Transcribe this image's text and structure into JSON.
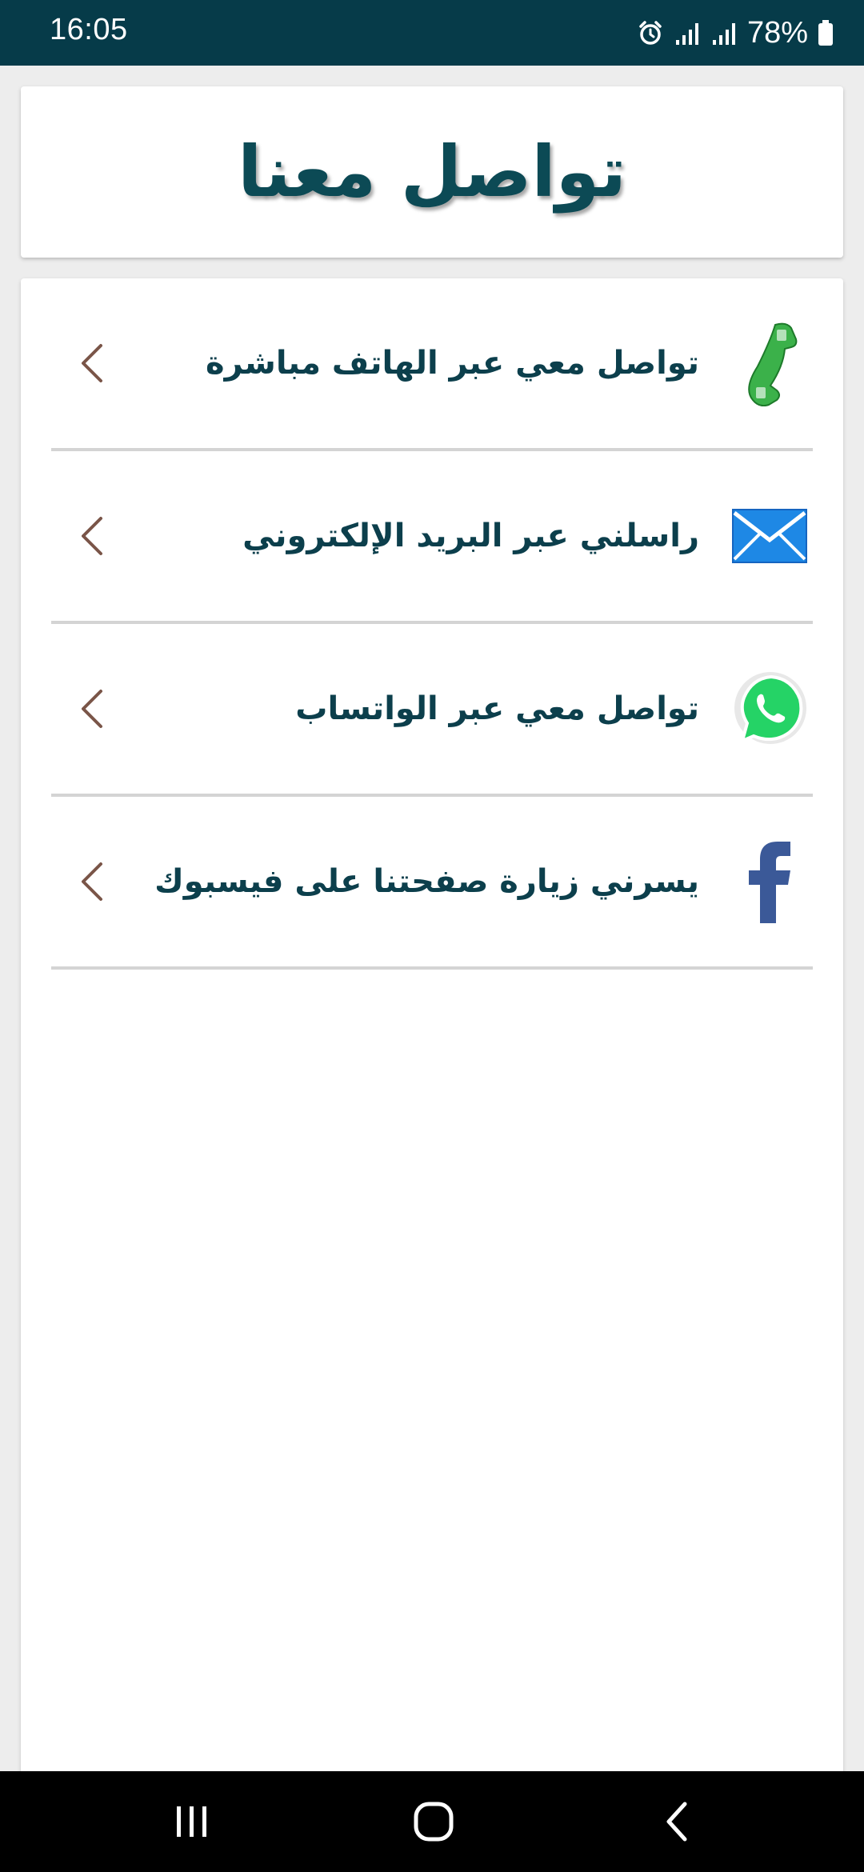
{
  "status_bar": {
    "time": "16:05",
    "battery": "78%",
    "icons": [
      "alarm-icon",
      "signal-icon",
      "signal-icon",
      "battery-icon"
    ]
  },
  "header": {
    "title": "تواصل معنا"
  },
  "contact_list": {
    "items": [
      {
        "label": "تواصل معي عبر الهاتف مباشرة",
        "icon": "phone-icon"
      },
      {
        "label": "راسلني عبر البريد الإلكتروني",
        "icon": "email-icon"
      },
      {
        "label": "تواصل معي عبر الواتساب",
        "icon": "whatsapp-icon"
      },
      {
        "label": "يسرني زيارة صفحتنا على فيسبوك",
        "icon": "facebook-icon"
      }
    ]
  },
  "navigation": {
    "buttons": [
      "recent-apps",
      "home",
      "back"
    ]
  },
  "colors": {
    "status_bar_bg": "#063b49",
    "title_text": "#0c4a55",
    "item_text": "#0c3f4c",
    "chevron": "#7a5548",
    "divider": "#d4d4d4",
    "phone_green": "#3bb14a",
    "email_blue": "#1e88e5",
    "whatsapp_green": "#25d366",
    "facebook_blue": "#3b5998"
  }
}
